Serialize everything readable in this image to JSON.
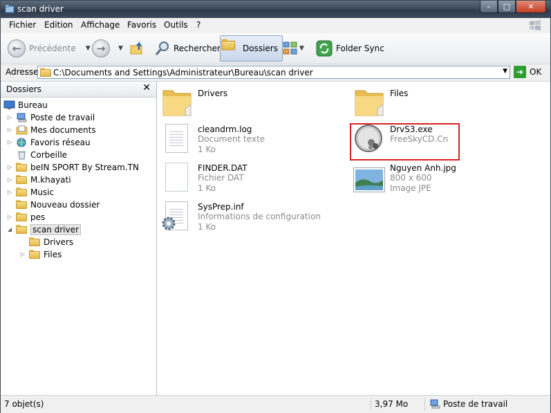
{
  "window": {
    "title": "scan driver",
    "minimize": "–",
    "maximize": "□",
    "close": "✕"
  },
  "menu": [
    "Fichier",
    "Edition",
    "Affichage",
    "Favoris",
    "Outils",
    "?"
  ],
  "toolbar": {
    "back_label": "Précédente",
    "back_icon": "arrow-left-icon",
    "forward_icon": "arrow-right-icon",
    "up_icon": "folder-up-icon",
    "search_label": "Rechercher",
    "folders_label": "Dossiers",
    "views_icon": "views-icon",
    "folder_sync_label": "Folder Sync"
  },
  "address": {
    "label": "Adresse",
    "path": "C:\\Documents and Settings\\Administrateur\\Bureau\\scan driver",
    "go_label": "OK"
  },
  "folders_pane": {
    "title": "Dossiers",
    "close": "✕",
    "items": [
      {
        "label": "Bureau",
        "icon": "desktop-icon"
      },
      {
        "label": "Poste de travail",
        "icon": "computer-icon"
      },
      {
        "label": "Mes documents",
        "icon": "documents-icon"
      },
      {
        "label": "Favoris réseau",
        "icon": "network-icon"
      },
      {
        "label": "Corbeille",
        "icon": "recycle-bin-icon"
      },
      {
        "label": "beIN SPORT By Stream.TN",
        "icon": "folder-icon"
      },
      {
        "label": "M.khayati",
        "icon": "folder-icon"
      },
      {
        "label": "Music",
        "icon": "folder-icon"
      },
      {
        "label": "Nouveau dossier",
        "icon": "folder-icon"
      },
      {
        "label": "pes",
        "icon": "folder-icon"
      },
      {
        "label": "scan driver",
        "icon": "folder-icon",
        "selected": true
      },
      {
        "label": "Drivers",
        "icon": "folder-icon"
      },
      {
        "label": "Files",
        "icon": "folder-icon"
      }
    ]
  },
  "files": [
    {
      "name": "Drivers",
      "icon": "folder-icon"
    },
    {
      "name": "Files",
      "icon": "folder-icon"
    },
    {
      "name": "cleandrm.log",
      "type": "Document texte",
      "size": "1 Ko",
      "icon": "text-document-icon"
    },
    {
      "name": "DrvS3.exe",
      "type": "FreeSkyCD.Cn",
      "icon": "application-icon",
      "highlighted": true
    },
    {
      "name": "FINDER.DAT",
      "type": "Fichier DAT",
      "size": "1 Ko",
      "icon": "blank-file-icon"
    },
    {
      "name": "Nguyen Anh.jpg",
      "type": "800 x 600",
      "size": "Image JPE",
      "icon": "image-thumbnail-icon"
    },
    {
      "name": "SysPrep.inf",
      "type": "Informations de configuration",
      "size": "1 Ko",
      "icon": "config-file-icon"
    }
  ],
  "status": {
    "objects": "7 objet(s)",
    "size": "3,97 Mo",
    "location": "Poste de travail"
  },
  "colors": {
    "titlebar": "#3f4c5c",
    "highlight_border": "#d42020",
    "folder": "#e5b94a"
  }
}
